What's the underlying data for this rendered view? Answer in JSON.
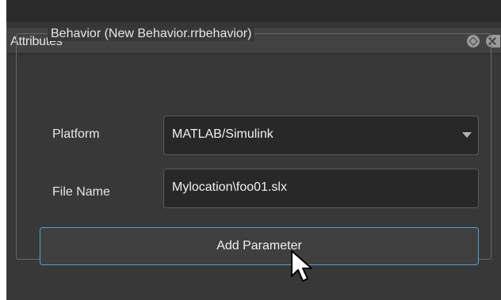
{
  "panel": {
    "title": "Attributes",
    "float_icon": "float-icon",
    "close_icon": "close-icon"
  },
  "behavior_group": {
    "legend": "Behavior (New Behavior.rrbehavior)",
    "platform": {
      "label": "Platform",
      "selected": "MATLAB/Simulink"
    },
    "file_name": {
      "label": "File Name",
      "value": "Mylocation\\foo01.slx"
    },
    "add_parameter_label": "Add Parameter"
  },
  "colors": {
    "panel_bg": "#383838",
    "field_bg": "#282828",
    "focus_border": "#4ba3d9",
    "text": "#e6e6e6"
  }
}
